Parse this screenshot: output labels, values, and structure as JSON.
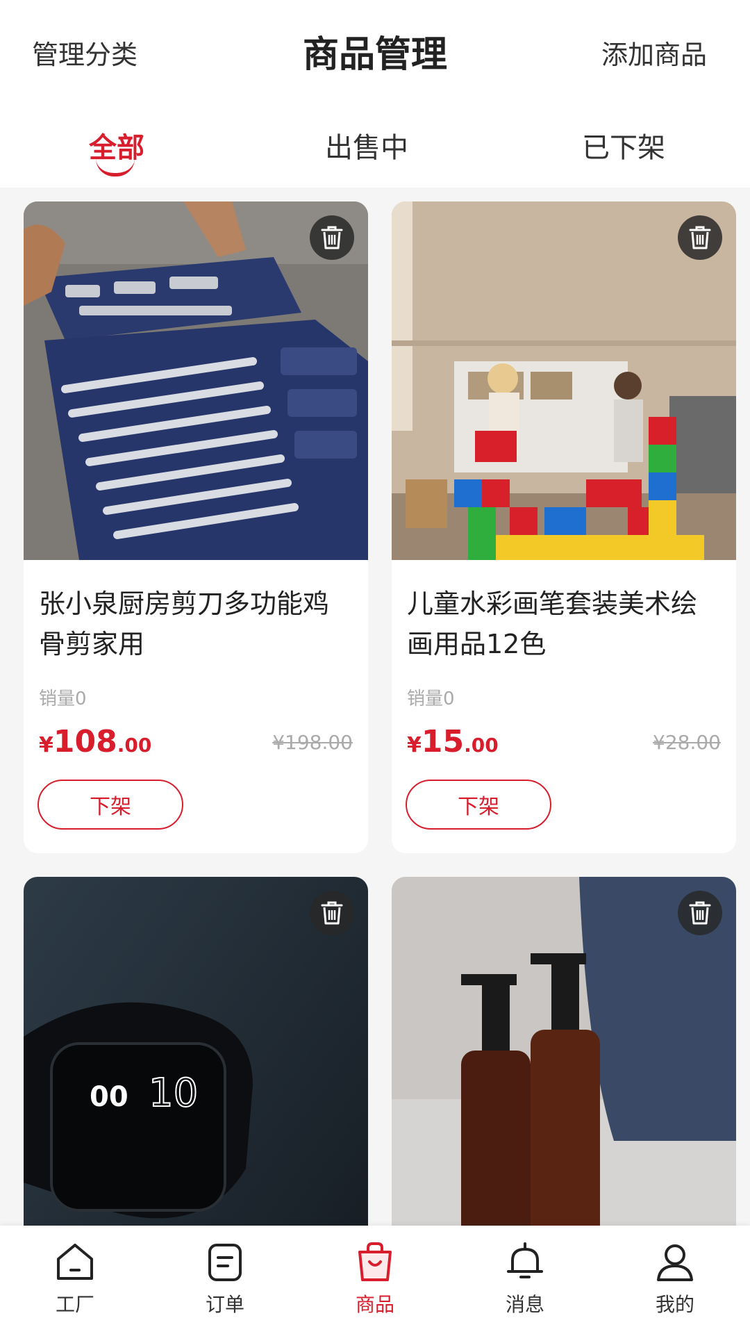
{
  "header": {
    "left_action": "管理分类",
    "title": "商品管理",
    "right_action": "添加商品"
  },
  "tabs": [
    {
      "label": "全部",
      "active": true
    },
    {
      "label": "出售中",
      "active": false
    },
    {
      "label": "已下架",
      "active": false
    }
  ],
  "products": [
    {
      "title": "张小泉厨房剪刀多功能鸡骨剪家用",
      "sales": "销量0",
      "price_currency": "¥",
      "price_int": "108",
      "price_dec": ".00",
      "original_price": "¥198.00",
      "action": "下架",
      "image": "tool-kit-photo"
    },
    {
      "title": "儿童水彩画笔套装美术绘画用品12色",
      "sales": "销量0",
      "price_currency": "¥",
      "price_int": "15",
      "price_dec": ".00",
      "original_price": "¥28.00",
      "action": "下架",
      "image": "kids-building-blocks-photo"
    },
    {
      "image": "smartwatch-photo"
    },
    {
      "image": "soap-dispenser-bottles-photo"
    }
  ],
  "bottom_nav": [
    {
      "label": "工厂",
      "icon": "home-icon",
      "active": false
    },
    {
      "label": "订单",
      "icon": "order-icon",
      "active": false
    },
    {
      "label": "商品",
      "icon": "shopping-bag-icon",
      "active": true
    },
    {
      "label": "消息",
      "icon": "bell-icon",
      "active": false
    },
    {
      "label": "我的",
      "icon": "user-icon",
      "active": false
    }
  ],
  "colors": {
    "accent": "#d81e2c",
    "background": "#f5f5f5",
    "text": "#222222",
    "muted": "#aaaaaa"
  }
}
